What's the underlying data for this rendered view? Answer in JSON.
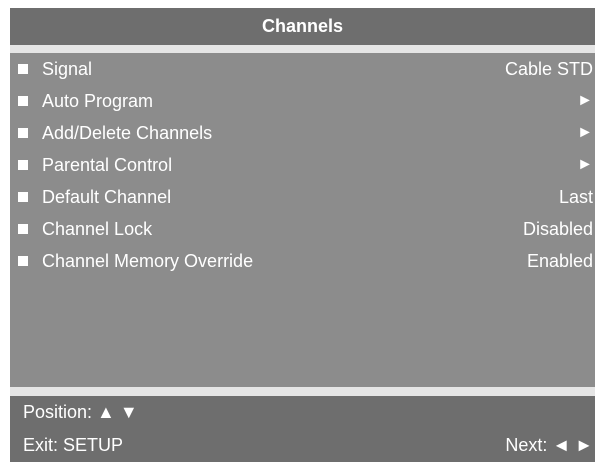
{
  "menu": {
    "title": "Channels",
    "items": [
      {
        "label": "Signal",
        "value": "Cable STD"
      },
      {
        "label": "Auto Program",
        "value": "►"
      },
      {
        "label": "Add/Delete Channels",
        "value": "►"
      },
      {
        "label": "Parental Control",
        "value": "►"
      },
      {
        "label": "Default Channel",
        "value": "Last"
      },
      {
        "label": "Channel Lock",
        "value": "Disabled"
      },
      {
        "label": "Channel Memory Override",
        "value": "Enabled"
      }
    ]
  },
  "footer": {
    "position_label": "Position: ▲ ▼",
    "exit_label": "Exit: SETUP",
    "next_label": "Next: ◄ ►"
  }
}
